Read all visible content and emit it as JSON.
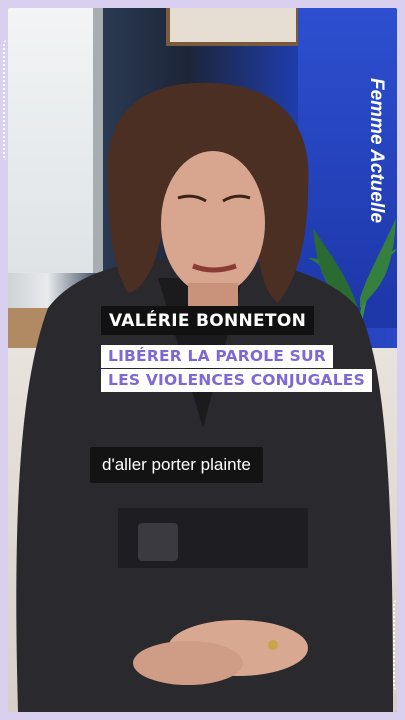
{
  "overlay": {
    "name": "VALÉRIE BONNETON",
    "subtitle_line1": "LIBÉRER LA PAROLE SUR",
    "subtitle_line2": "LES VIOLENCES CONJUGALES",
    "caption": "d'aller porter plainte",
    "brand": "Femme Actuelle"
  },
  "colors": {
    "accent_purple": "#7e67d6",
    "border_lavender": "#d9d0f0",
    "name_bg": "#111111"
  }
}
